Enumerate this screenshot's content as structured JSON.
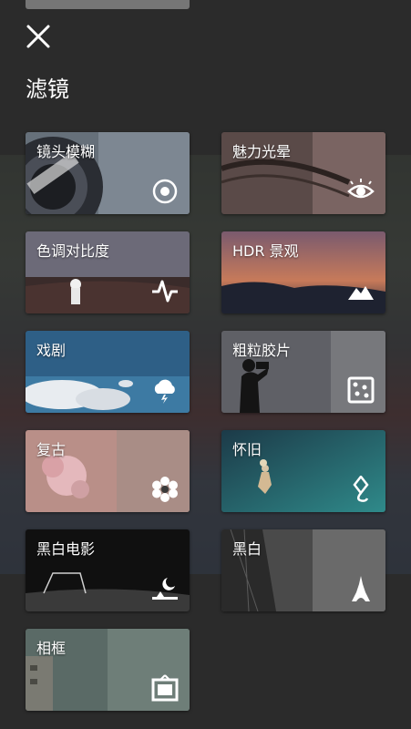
{
  "header": {
    "title": "滤镜",
    "close_icon": "close-icon"
  },
  "filters": [
    {
      "label": "镜头模糊",
      "icon": "target-icon"
    },
    {
      "label": "魅力光晕",
      "icon": "eye-icon"
    },
    {
      "label": "色调对比度",
      "icon": "pulse-icon"
    },
    {
      "label": "HDR 景观",
      "icon": "mountain-icon"
    },
    {
      "label": "戏剧",
      "icon": "storm-cloud-icon"
    },
    {
      "label": "粗粒胶片",
      "icon": "dice-icon"
    },
    {
      "label": "复古",
      "icon": "flower-icon"
    },
    {
      "label": "怀旧",
      "icon": "kite-icon"
    },
    {
      "label": "黑白电影",
      "icon": "moon-night-icon"
    },
    {
      "label": "黑白",
      "icon": "eiffel-tower-icon"
    },
    {
      "label": "相框",
      "icon": "frame-icon"
    }
  ]
}
